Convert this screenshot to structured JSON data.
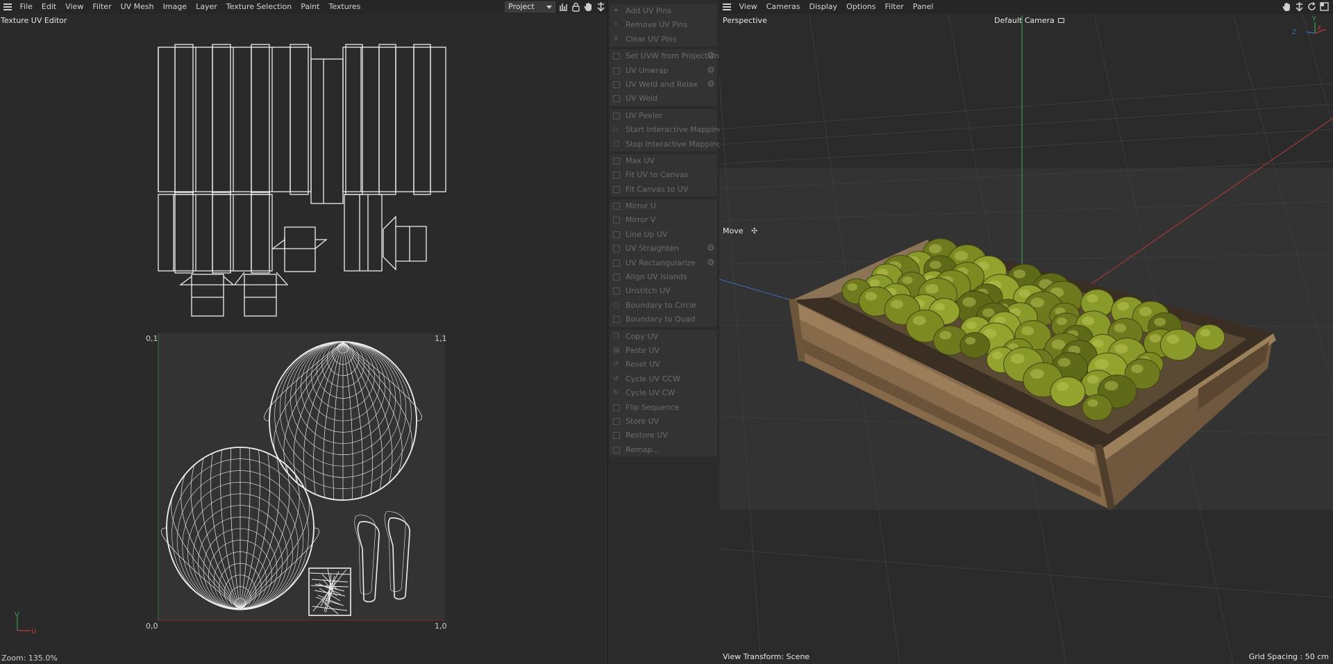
{
  "uv_editor": {
    "menu": [
      "File",
      "Edit",
      "View",
      "Filter",
      "UV Mesh",
      "Image",
      "Layer",
      "Texture Selection",
      "Paint",
      "Textures"
    ],
    "title": "Texture UV Editor",
    "project_select": "Project",
    "corner_labels": {
      "top_left": "0,1",
      "top_right": "1,1",
      "bottom_left": "0,0",
      "bottom_right": "1,0"
    },
    "axis_labels": {
      "v": "V",
      "u": "U"
    },
    "zoom_label": "Zoom: 135.0%",
    "icons": [
      "histogram-icon",
      "lock-icon",
      "hand-icon",
      "move-down-icon"
    ]
  },
  "commands": {
    "groups": [
      {
        "items": [
          {
            "label": "Add UV Pins",
            "icon": "pin-add-icon"
          },
          {
            "label": "Remove UV Pins",
            "icon": "pin-remove-icon"
          },
          {
            "label": "Clear UV Pins",
            "icon": "pin-clear-icon"
          }
        ]
      },
      {
        "items": [
          {
            "label": "Set UVW from Projection",
            "icon": "projection-icon",
            "gear": true
          },
          {
            "label": "UV Unwrap",
            "icon": "unwrap-icon",
            "gear": true
          },
          {
            "label": "UV Weld and Relax",
            "icon": "weld-relax-icon",
            "gear": true
          },
          {
            "label": "UV Weld",
            "icon": "weld-icon"
          }
        ]
      },
      {
        "items": [
          {
            "label": "UV Peeler",
            "icon": "peeler-icon"
          },
          {
            "label": "Start Interactive Mapping",
            "icon": "play-icon"
          },
          {
            "label": "Stop Interactive Mapping",
            "icon": "stop-icon"
          }
        ]
      },
      {
        "items": [
          {
            "label": "Max UV",
            "icon": "max-uv-icon"
          },
          {
            "label": "Fit UV to Canvas",
            "icon": "fit-uv-icon"
          },
          {
            "label": "Fit Canvas to UV",
            "icon": "fit-canvas-icon"
          }
        ]
      },
      {
        "items": [
          {
            "label": "Mirror U",
            "icon": "mirror-u-icon"
          },
          {
            "label": "Mirror V",
            "icon": "mirror-v-icon"
          },
          {
            "label": "Line Up UV",
            "icon": "line-up-icon"
          },
          {
            "label": "UV Straighten",
            "icon": "straighten-icon",
            "gear": true
          },
          {
            "label": "UV Rectangularize",
            "icon": "rectangularize-icon",
            "gear": true
          },
          {
            "label": "Align UV Islands",
            "icon": "align-icon"
          },
          {
            "label": "Unstitch UV",
            "icon": "unstitch-icon"
          },
          {
            "label": "Boundary to Circle",
            "icon": "circle-icon"
          },
          {
            "label": "Boundary to Quad",
            "icon": "quad-icon"
          }
        ]
      },
      {
        "items": [
          {
            "label": "Copy UV",
            "icon": "copy-icon"
          },
          {
            "label": "Paste UV",
            "icon": "paste-icon"
          },
          {
            "label": "Reset UV",
            "icon": "reset-icon"
          },
          {
            "label": "Cycle UV CCW",
            "icon": "cycle-ccw-icon"
          },
          {
            "label": "Cycle UV CW",
            "icon": "cycle-cw-icon"
          },
          {
            "label": "Flip Sequence",
            "icon": "flip-icon"
          },
          {
            "label": "Store UV",
            "icon": "store-icon"
          },
          {
            "label": "Restore UV",
            "icon": "restore-icon"
          },
          {
            "label": "Remap...",
            "icon": "remap-icon"
          }
        ]
      }
    ]
  },
  "viewport": {
    "menu": [
      "View",
      "Cameras",
      "Display",
      "Options",
      "Filter",
      "Panel"
    ],
    "view_name": "Perspective",
    "camera": "Default Camera",
    "tool": "Move",
    "view_transform": "View Transform: Scene",
    "grid_spacing": "Grid Spacing : 50 cm",
    "axis_gizmo": {
      "x": "X",
      "y": "Y",
      "z": "Z"
    },
    "icons": [
      "hand-icon",
      "move-down-icon",
      "orbit-icon",
      "maximize-icon"
    ]
  }
}
